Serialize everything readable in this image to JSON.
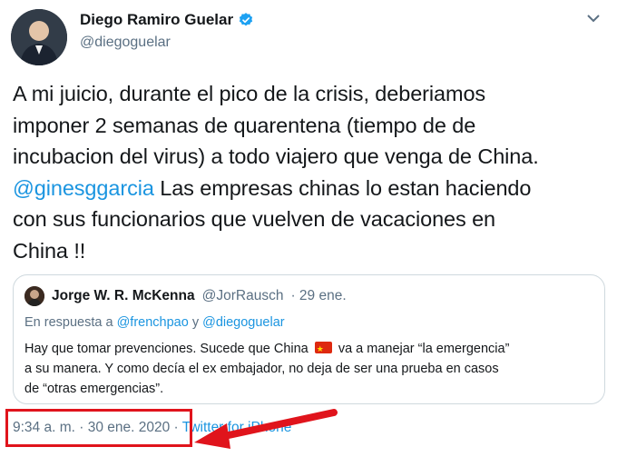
{
  "author": {
    "name": "Diego Ramiro Guelar",
    "handle": "@diegoguelar",
    "verified": true
  },
  "tweet": {
    "lines": [
      "A mi juicio, durante el pico de la crisis, deberiamos",
      "imponer 2 semanas de quarentena (tiempo de de",
      "incubacion del virus) a todo viajero que venga de China."
    ],
    "mention": "@ginesggarcia",
    "line4_rest": " Las empresas chinas lo estan haciendo",
    "line5": "con sus funcionarios que vuelven de vacaciones en",
    "line6": "China !!"
  },
  "quote": {
    "name": "Jorge W. R. McKenna",
    "handle": "@JorRausch",
    "date": "· 29 ene.",
    "reply_prefix": "En respuesta a ",
    "reply_mention_1": "@frenchpao",
    "reply_and": " y ",
    "reply_mention_2": "@diegoguelar",
    "text_line1_a": "Hay que tomar prevenciones. Sucede que China",
    "text_line1_b": "va a manejar “la emergencia”",
    "text_line2": "a su manera. Y como decía el ex embajador, no deja de ser una prueba en casos",
    "text_line3": "de “otras emergencias”."
  },
  "meta": {
    "time": "9:34 a. m. · 30 ene. 2020 · ",
    "source": "Twitter for iPhone"
  },
  "colors": {
    "link": "#1b95e0",
    "secondary_text": "#5b7083",
    "annotation": "#e0141c",
    "verified_badge": "#1da1f2"
  }
}
